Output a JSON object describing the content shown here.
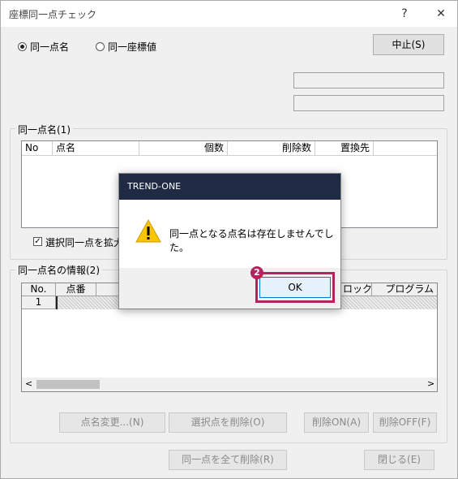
{
  "window": {
    "title": "座標同一点チェック",
    "help": "?",
    "close": "✕"
  },
  "mode": {
    "option1": "同一点名",
    "option2": "同一座標値"
  },
  "buttons": {
    "stop": "中止(S)",
    "rename": "点名変更...(N)",
    "delete_selected": "選択点を削除(O)",
    "delete_on": "削除ON(A)",
    "delete_off": "削除OFF(F)",
    "delete_all": "同一点を全て削除(R)",
    "close": "閉じる(E)"
  },
  "group1": {
    "label": "同一点名(1)",
    "columns": [
      "No",
      "点名",
      "個数",
      "削除数",
      "置換先"
    ],
    "checkbox_label": "選択同一点を拡大"
  },
  "group2": {
    "label": "同一点名の情報(2)",
    "columns": [
      "No.",
      "点番",
      "ロック",
      "プログラム"
    ],
    "row_no": "1",
    "scroll_left": "<",
    "scroll_right": ">"
  },
  "dialog": {
    "title": "TREND-ONE",
    "message": "同一点となる点名は存在しませんでした。",
    "ok": "OK",
    "badge": "2"
  },
  "colors": {
    "dialog_title_bg": "#1f2b45",
    "highlight": "#b3245e"
  }
}
